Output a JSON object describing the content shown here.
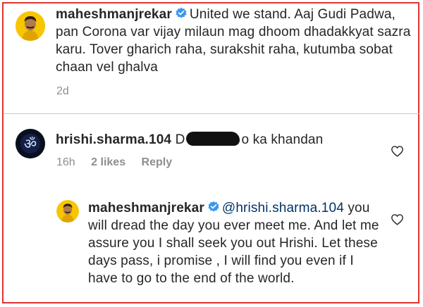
{
  "post": {
    "username": "maheshmanjrekar",
    "caption": "United we stand. Aaj Gudi Padwa, pan Corona var vijay milaun mag dhoom dhadakkyat sazra karu. Tover gharich raha, surakshit raha, kutumba sobat chaan vel ghalva",
    "time": "2d"
  },
  "comment": {
    "username": "hrishi.sharma.104",
    "text_prefix": "D",
    "text_suffix": "o ka khandan",
    "time": "16h",
    "likes": "2 likes",
    "reply": "Reply"
  },
  "reply": {
    "username": "maheshmanjrekar",
    "mention": "@hrishi.sharma.104",
    "text": "you will dread the day you ever meet me. And let me assure you I shall seek you out Hrishi. Let these days pass, i promise , I will find you even if I have to go to the end of the world."
  },
  "colors": {
    "verified": "#3897f0",
    "frame": "#e2322f",
    "muted": "#8e8e8e",
    "mention": "#003569"
  }
}
